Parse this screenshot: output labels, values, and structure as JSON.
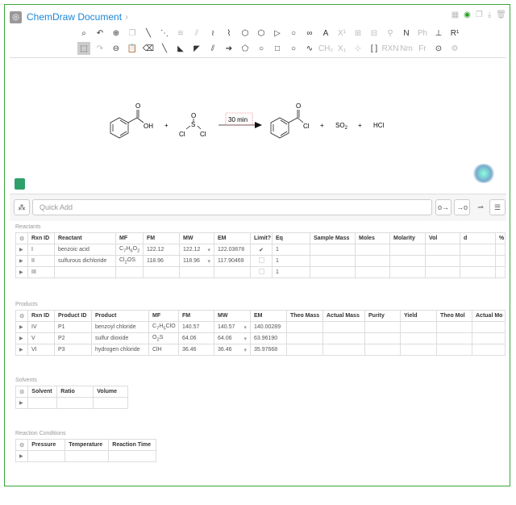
{
  "app": {
    "title": "ChemDraw Document"
  },
  "toolbar": {
    "row1": [
      {
        "icon": "lasso-icon",
        "g": "⌕"
      },
      {
        "icon": "undo-icon",
        "g": "↶"
      },
      {
        "icon": "zoom-in-icon",
        "g": "⊕"
      },
      {
        "icon": "copy-icon",
        "g": "❐",
        "dim": true
      },
      {
        "icon": "single-bond-icon",
        "g": "╲"
      },
      {
        "icon": "dashed-bond-icon",
        "g": "⋱"
      },
      {
        "icon": "triple-bond-icon",
        "g": "≋",
        "dim": true
      },
      {
        "icon": "hashed-bond-icon",
        "g": "⫽",
        "dim": true
      },
      {
        "icon": "wavy-bond-icon",
        "g": "≀"
      },
      {
        "icon": "chain-icon",
        "g": "⌇"
      },
      {
        "icon": "benzene-icon",
        "g": "⬡"
      },
      {
        "icon": "cyclohexane-icon",
        "g": "⬡"
      },
      {
        "icon": "triangle-icon",
        "g": "▷"
      },
      {
        "icon": "circle-icon",
        "g": "○"
      },
      {
        "icon": "bicycle-icon",
        "g": "∞"
      },
      {
        "icon": "text-icon",
        "g": "A"
      },
      {
        "icon": "superscript-icon",
        "g": "X¹",
        "dim": true
      },
      {
        "icon": "template-icon",
        "g": "⊞",
        "dim": true
      },
      {
        "icon": "template2-icon",
        "g": "⊟",
        "dim": true
      },
      {
        "icon": "structure-clean-icon",
        "g": "⚲",
        "dim": true
      },
      {
        "icon": "name-to-structure-icon",
        "g": "N"
      },
      {
        "icon": "ph-icon",
        "g": "Ph",
        "dim": true
      },
      {
        "icon": "stamp-icon",
        "g": "⊥"
      },
      {
        "icon": "r-group-icon",
        "g": "R¹"
      }
    ],
    "row2": [
      {
        "icon": "select-icon",
        "g": "⬚",
        "sel": true
      },
      {
        "icon": "redo-icon",
        "g": "↷",
        "dim": true
      },
      {
        "icon": "zoom-out-icon",
        "g": "⊖"
      },
      {
        "icon": "paste-icon",
        "g": "📋"
      },
      {
        "icon": "eraser-icon",
        "g": "⌫"
      },
      {
        "icon": "bold-bond-icon",
        "g": "╲"
      },
      {
        "icon": "wedge-bond-icon",
        "g": "◣"
      },
      {
        "icon": "hashed-wedge-icon",
        "g": "◤"
      },
      {
        "icon": "double-bond-icon",
        "g": "⫽"
      },
      {
        "icon": "arrow-icon",
        "g": "➔"
      },
      {
        "icon": "pentagon-icon",
        "g": "⬠"
      },
      {
        "icon": "cycloheptane-icon",
        "g": "○"
      },
      {
        "icon": "square-icon",
        "g": "□"
      },
      {
        "icon": "cyclooctane-icon",
        "g": "○"
      },
      {
        "icon": "curve-icon",
        "g": "∿"
      },
      {
        "icon": "ch2-icon",
        "g": "CH₂",
        "dim": true
      },
      {
        "icon": "subscript-icon",
        "g": "X₁",
        "dim": true
      },
      {
        "icon": "grid-icon",
        "g": "⊹",
        "dim": true
      },
      {
        "icon": "bracket-icon",
        "g": "[ ]"
      },
      {
        "icon": "reaction-icon",
        "g": "RXN",
        "dim": true
      },
      {
        "icon": "name-icon",
        "g": "Nm",
        "dim": true
      },
      {
        "icon": "fragment-icon",
        "g": "Fr",
        "dim": true
      },
      {
        "icon": "charge-icon",
        "g": "⊙"
      },
      {
        "icon": "settings-icon",
        "g": "⚙",
        "dim": true
      }
    ]
  },
  "reaction": {
    "condition": "30 min",
    "reactant1_label": "OH",
    "reactant2_atoms": [
      "O",
      "S",
      "Cl",
      "Cl"
    ],
    "product1_label": "Cl",
    "product1_o": "O",
    "reactant1_o": "O",
    "product2": "SO",
    "product2_sub": "2",
    "product3": "HCl",
    "plus": "+"
  },
  "quick_add": {
    "placeholder": "Quick Add"
  },
  "reactants": {
    "label": "Reactants",
    "columns": [
      "Rxn ID",
      "Reactant",
      "MF",
      "FM",
      "MW",
      "EM",
      "Limit?",
      "Eq",
      "Sample Mass",
      "Moles",
      "Molarity",
      "Vol",
      "d",
      "%"
    ],
    "rows": [
      {
        "rxn_id": "I",
        "name": "benzoic acid",
        "mf": "C7H6O2",
        "fm": "122.12",
        "mw": "122.12",
        "em": "122.03678",
        "limit": true,
        "eq": "1"
      },
      {
        "rxn_id": "II",
        "name": "sulfurous dichloride",
        "mf": "Cl2OS",
        "fm": "118.96",
        "mw": "118.96",
        "em": "117.90469",
        "limit": false,
        "eq": "1"
      },
      {
        "rxn_id": "III",
        "name": "",
        "mf": "",
        "fm": "",
        "mw": "",
        "em": "",
        "limit": false,
        "eq": "1"
      }
    ]
  },
  "products": {
    "label": "Products",
    "columns": [
      "Rxn ID",
      "Product ID",
      "Product",
      "MF",
      "FM",
      "MW",
      "EM",
      "Theo Mass",
      "Actual Mass",
      "Purity",
      "Yield",
      "Theo Mol",
      "Actual Mo"
    ],
    "rows": [
      {
        "rxn_id": "IV",
        "pid": "P1",
        "name": "benzoyl chloride",
        "mf": "C7H5ClO",
        "fm": "140.57",
        "mw": "140.57",
        "em": "140.00289"
      },
      {
        "rxn_id": "V",
        "pid": "P2",
        "name": "sulfur dioxide",
        "mf": "O2S",
        "fm": "64.06",
        "mw": "64.06",
        "em": "63.96190"
      },
      {
        "rxn_id": "VI",
        "pid": "P3",
        "name": "hydrogen chloride",
        "mf": "ClH",
        "fm": "36.46",
        "mw": "36.46",
        "em": "35.97668"
      }
    ]
  },
  "solvents": {
    "label": "Solvents",
    "columns": [
      "Solvent",
      "Ratio",
      "Volume"
    ]
  },
  "conditions": {
    "label": "Reaction Conditions",
    "columns": [
      "Pressure",
      "Temperature",
      "Reaction Time"
    ]
  }
}
